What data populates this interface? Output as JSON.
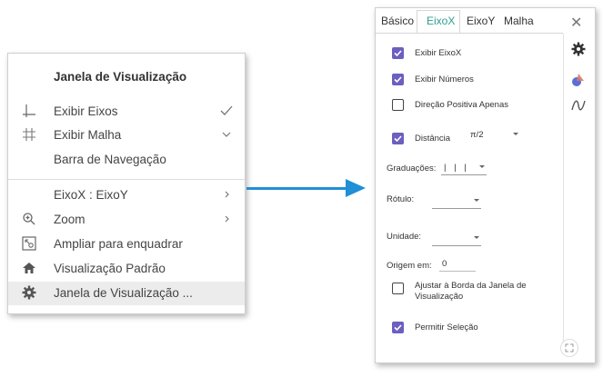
{
  "context_menu": {
    "title": "Janela de Visualização",
    "items": [
      {
        "label": "Exibir Eixos",
        "icon": "axes-icon",
        "right": "check-icon"
      },
      {
        "label": "Exibir Malha",
        "icon": "grid-icon",
        "right": "chevron-down-icon"
      },
      {
        "label": "Barra de Navegação",
        "icon": "",
        "right": ""
      },
      {
        "label": "EixoX : EixoY",
        "icon": "",
        "right": "chevron-right-icon"
      },
      {
        "label": "Zoom",
        "icon": "zoom-icon",
        "right": "chevron-right-icon"
      },
      {
        "label": "Ampliar para enquadrar",
        "icon": "zoom-to-fit-icon",
        "right": ""
      },
      {
        "label": "Visualização Padrão",
        "icon": "home-icon",
        "right": ""
      },
      {
        "label": "Janela de Visualização ...",
        "icon": "gear-icon",
        "right": ""
      }
    ]
  },
  "settings_panel": {
    "tabs": [
      "Básico",
      "EixoX",
      "EixoY",
      "Malha"
    ],
    "active_tab": "EixoX",
    "options": {
      "show_axis": {
        "label": "Exibir EixoX",
        "checked": true
      },
      "show_numbers": {
        "label": "Exibir Números",
        "checked": true
      },
      "positive_direction": {
        "label": "Direção Positiva Apenas",
        "checked": false
      },
      "distance": {
        "label": "Distância",
        "checked": true,
        "value": "π/2"
      },
      "tick_style": {
        "label": "Graduações:",
        "value": "| | |"
      },
      "label": {
        "label": "Rótulo:",
        "value": ""
      },
      "unit": {
        "label": "Unidade:",
        "value": ""
      },
      "origin": {
        "label": "Origem em:",
        "value": "0"
      },
      "stick_to_edge": {
        "label": "Ajustar à Borda da Janela de Visualização",
        "label_line1": "Ajustar à Borda da Janela de",
        "label_line2": "Visualização",
        "checked": false
      },
      "allow_selection": {
        "label": "Permitir Seleção",
        "checked": true
      }
    }
  },
  "colors": {
    "accent_tab": "#2f9d8f",
    "checkbox_on": "#6b5fbf",
    "arrow": "#1f8fd6"
  }
}
